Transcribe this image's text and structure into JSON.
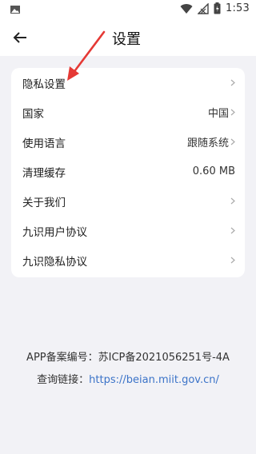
{
  "status_bar": {
    "time": "1:53",
    "icons": [
      "image-icon",
      "wifi-icon",
      "signal-icon",
      "battery-icon"
    ]
  },
  "header": {
    "title": "设置",
    "back_icon": "arrow-left-icon"
  },
  "settings": {
    "items": [
      {
        "label": "隐私设置",
        "value": "",
        "chevron": true
      },
      {
        "label": "国家",
        "value": "中国",
        "chevron": true
      },
      {
        "label": "使用语言",
        "value": "跟随系统",
        "chevron": true
      },
      {
        "label": "清理缓存",
        "value": "0.60 MB",
        "chevron": false
      },
      {
        "label": "关于我们",
        "value": "",
        "chevron": true
      },
      {
        "label": "九识用户协议",
        "value": "",
        "chevron": true
      },
      {
        "label": "九识隐私协议",
        "value": "",
        "chevron": true
      }
    ]
  },
  "footer": {
    "record_label": "APP备案编号：苏ICP备2021056251号-4A",
    "query_label": "查询链接：",
    "query_link": "https://beian.miit.gov.cn/"
  },
  "colors": {
    "background": "#f2f2f6",
    "link": "#3b73c8",
    "annotation_arrow": "#e53935"
  }
}
